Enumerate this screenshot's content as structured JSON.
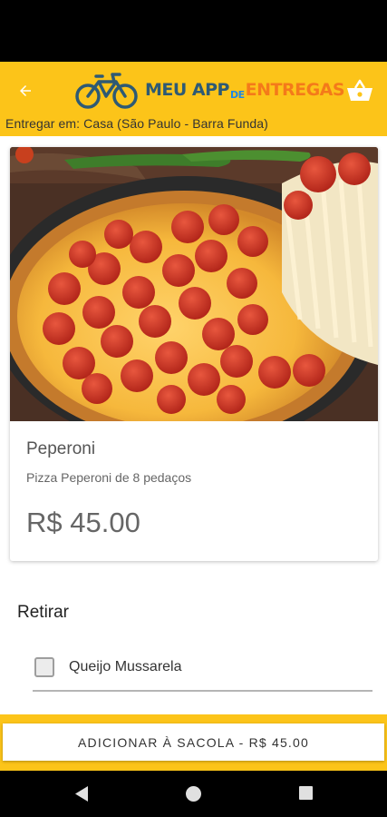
{
  "app_bar": {
    "logo_meu": "MEU APP",
    "logo_de": "DE",
    "logo_entregas": "ENTREGAS",
    "deliver_to": "Entregar em: Casa (São Paulo - Barra Funda)",
    "accent_color": "#fcc419"
  },
  "product": {
    "name": "Peperoni",
    "description": "Pizza Peperoni de 8 pedaços",
    "price": "R$ 45.00",
    "image_icon": "pepperoni-pizza-image"
  },
  "options_section": {
    "title": "Retirar",
    "items": [
      {
        "label": "Queijo Mussarela",
        "checked": false
      }
    ]
  },
  "bottom_bar": {
    "add_button_label": "ADICIONAR À SACOLA - R$ 45.00"
  },
  "icons": {
    "back": "arrow-back-icon",
    "basket": "shopping-basket-icon",
    "logo": "bicycle-icon"
  }
}
